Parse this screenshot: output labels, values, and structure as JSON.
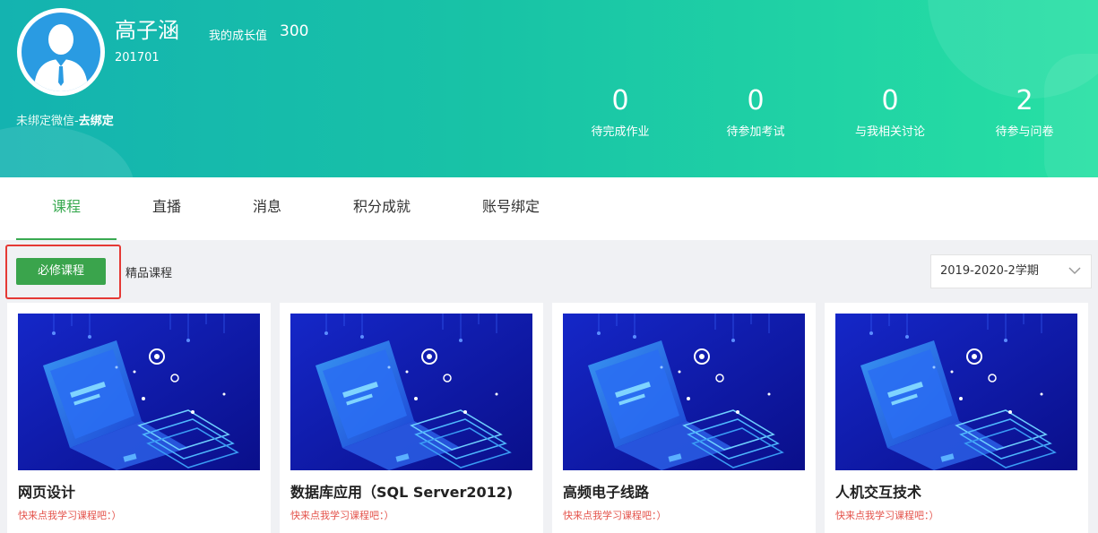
{
  "profile": {
    "name": "高子涵",
    "student_id": "201701",
    "growth_label": "我的成长值",
    "growth_value": "300",
    "wechat_text": "未绑定微信-",
    "wechat_link": "去绑定",
    "avatar_icon": "user-avatar-icon"
  },
  "stats": [
    {
      "value": "0",
      "label": "待完成作业"
    },
    {
      "value": "0",
      "label": "待参加考试"
    },
    {
      "value": "0",
      "label": "与我相关讨论"
    },
    {
      "value": "2",
      "label": "待参与问卷"
    }
  ],
  "tabs": [
    {
      "label": "课程",
      "active": true
    },
    {
      "label": "直播",
      "active": false
    },
    {
      "label": "消息",
      "active": false
    },
    {
      "label": "积分成就",
      "active": false
    },
    {
      "label": "账号绑定",
      "active": false
    }
  ],
  "filters": {
    "required_label": "必修课程",
    "premium_label": "精品课程",
    "term_selected": "2019-2020-2学期"
  },
  "courses": [
    {
      "title": "网页设计",
      "hint": "快来点我学习课程吧：）"
    },
    {
      "title": "数据库应用（SQL Server2012)",
      "hint": "快来点我学习课程吧：）"
    },
    {
      "title": "高频电子线路",
      "hint": "快来点我学习课程吧：）"
    },
    {
      "title": "人机交互技术",
      "hint": "快来点我学习课程吧：）"
    }
  ],
  "colors": {
    "accent": "#3aaa52",
    "header_start": "#14b3b0",
    "header_end": "#27e0a4",
    "hint": "#e4534b",
    "highlight": "#e53935"
  }
}
